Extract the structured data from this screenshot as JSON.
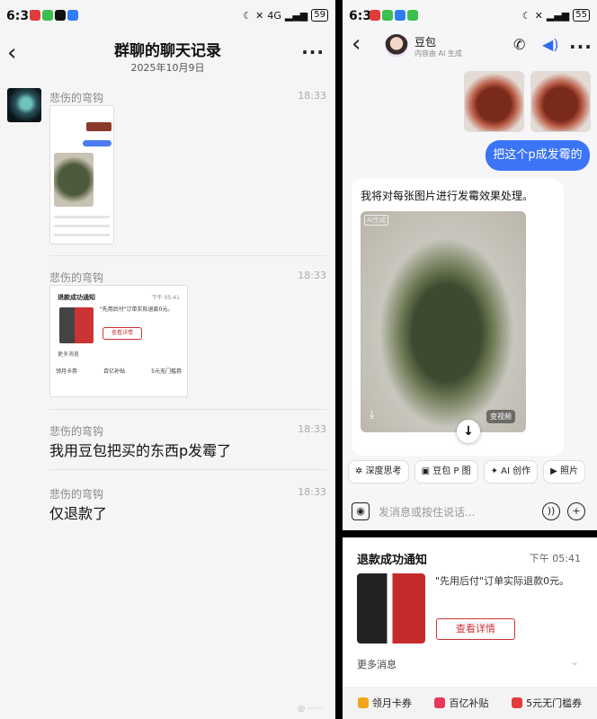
{
  "left": {
    "status": {
      "time": "6:37",
      "battery": "59",
      "network": "4G"
    },
    "header": {
      "title": "群聊的聊天记录",
      "date": "2025年10月9日"
    },
    "messages": [
      {
        "sender": "悲伤的弯钩",
        "time": "18:33"
      },
      {
        "sender": "悲伤的弯钩",
        "time": "18:33"
      },
      {
        "sender": "悲伤的弯钩",
        "time": "18:33",
        "text": "我用豆包把买的东西p发霉了"
      },
      {
        "sender": "悲伤的弯钩",
        "time": "18:33",
        "text": "仅退款了"
      }
    ],
    "nested_card": {
      "title": "退款成功通知",
      "time": "下午 05:41",
      "text": "\"先用后付\"订单实际退款0元。",
      "button": "查看详情",
      "more": "更多消息",
      "footer": [
        "领月卡券",
        "百亿补贴",
        "5元无门槛券"
      ]
    }
  },
  "right_top": {
    "status": {
      "time": "6:32",
      "battery": "55"
    },
    "bot_name": "豆包",
    "bot_sub": "内容由 AI 生成",
    "user_message": "把这个p成发霉的",
    "bot_reply": "我将对每张图片进行发霉效果处理。",
    "image_tag": "AI生成",
    "video_label": "变视频",
    "chips": [
      "深度思考",
      "豆包 P 图",
      "AI 创作",
      "照片"
    ],
    "input_placeholder": "发消息或按住说话..."
  },
  "right_bottom": {
    "title": "退款成功通知",
    "time": "下午 05:41",
    "text": "\"先用后付\"订单实际退款0元。",
    "button": "查看详情",
    "more": "更多消息",
    "footer": [
      "领月卡券",
      "百亿补贴",
      "5元无门槛券"
    ]
  }
}
